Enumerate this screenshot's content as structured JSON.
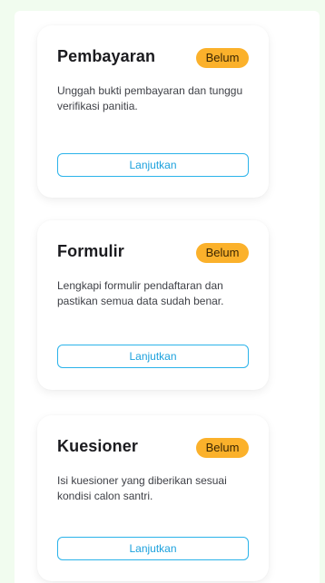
{
  "cards": [
    {
      "title": "Pembayaran",
      "status": "Belum",
      "description": "Unggah bukti pembayaran dan tunggu verifikasi panitia.",
      "button_label": "Lanjutkan"
    },
    {
      "title": "Formulir",
      "status": "Belum",
      "description": "Lengkapi formulir pendaftaran dan pastikan semua data sudah benar.",
      "button_label": "Lanjutkan"
    },
    {
      "title": "Kuesioner",
      "status": "Belum",
      "description": "Isi kuesioner yang diberikan sesuai kondisi calon santri.",
      "button_label": "Lanjutkan"
    }
  ],
  "colors": {
    "page_background": "#f1fcef",
    "badge": "#fbb12b",
    "button_accent": "#1ba1dd"
  }
}
